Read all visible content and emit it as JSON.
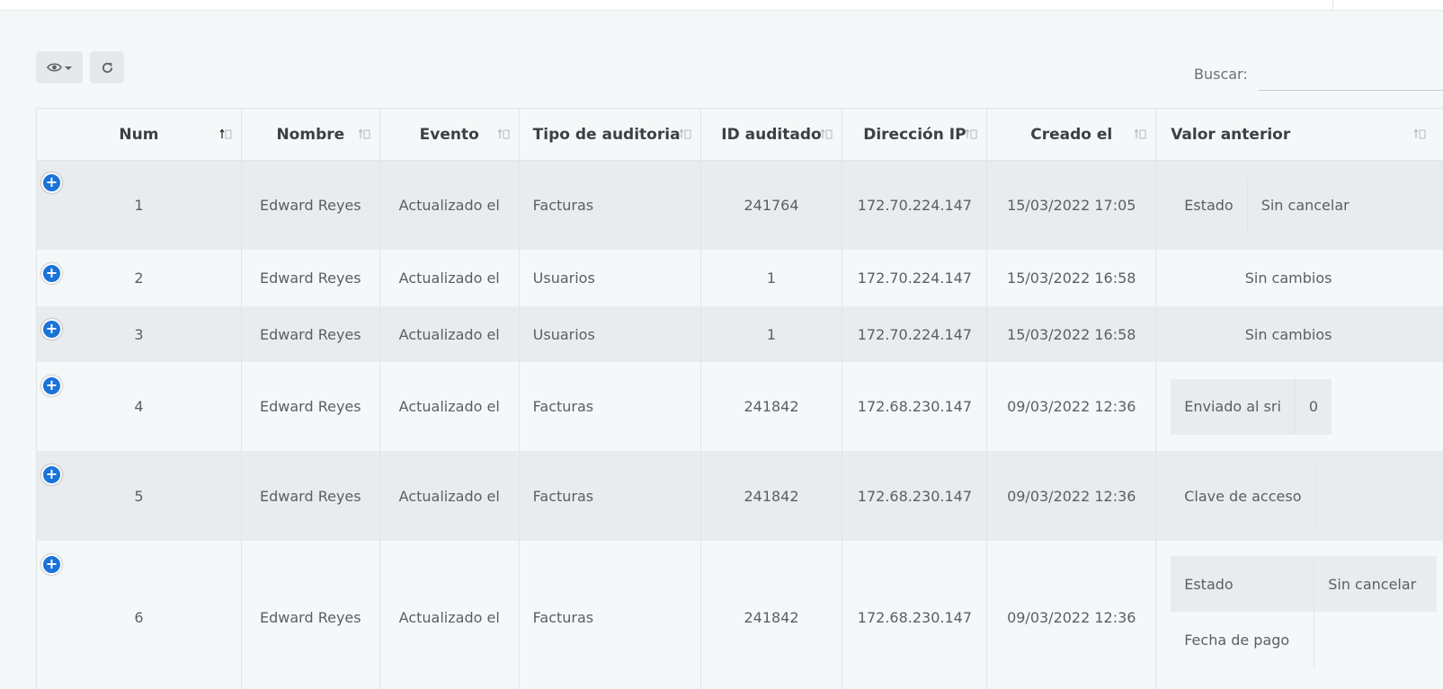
{
  "toolbar": {
    "columns_icon": "eye-icon",
    "refresh_icon": "refresh-icon",
    "search_label": "Buscar:",
    "search_value": ""
  },
  "table": {
    "columns": [
      "Num",
      "Nombre",
      "Evento",
      "Tipo de auditoria",
      "ID auditado",
      "Dirección IP",
      "Creado el",
      "Valor anterior"
    ],
    "rows": [
      {
        "num": "1",
        "nombre": "Edward Reyes",
        "evento": "Actualizado el",
        "tipo": "Facturas",
        "id": "241764",
        "ip": "172.70.224.147",
        "creado": "15/03/2022 17:05",
        "valor": [
          {
            "k": "Estado",
            "v": "Sin cancelar"
          }
        ]
      },
      {
        "num": "2",
        "nombre": "Edward Reyes",
        "evento": "Actualizado el",
        "tipo": "Usuarios",
        "id": "1",
        "ip": "172.70.224.147",
        "creado": "15/03/2022 16:58",
        "valor_text": "Sin cambios"
      },
      {
        "num": "3",
        "nombre": "Edward Reyes",
        "evento": "Actualizado el",
        "tipo": "Usuarios",
        "id": "1",
        "ip": "172.70.224.147",
        "creado": "15/03/2022 16:58",
        "valor_text": "Sin cambios"
      },
      {
        "num": "4",
        "nombre": "Edward Reyes",
        "evento": "Actualizado el",
        "tipo": "Facturas",
        "id": "241842",
        "ip": "172.68.230.147",
        "creado": "09/03/2022 12:36",
        "valor": [
          {
            "k": "Enviado al sri",
            "v": "0"
          }
        ]
      },
      {
        "num": "5",
        "nombre": "Edward Reyes",
        "evento": "Actualizado el",
        "tipo": "Facturas",
        "id": "241842",
        "ip": "172.68.230.147",
        "creado": "09/03/2022 12:36",
        "valor": [
          {
            "k": "Clave de acceso",
            "v": ""
          }
        ]
      },
      {
        "num": "6",
        "nombre": "Edward Reyes",
        "evento": "Actualizado el",
        "tipo": "Facturas",
        "id": "241842",
        "ip": "172.68.230.147",
        "creado": "09/03/2022 12:36",
        "valor": [
          {
            "k": "Estado",
            "v": "Sin cancelar"
          },
          {
            "k": "Fecha de pago",
            "v": ""
          }
        ]
      }
    ]
  }
}
